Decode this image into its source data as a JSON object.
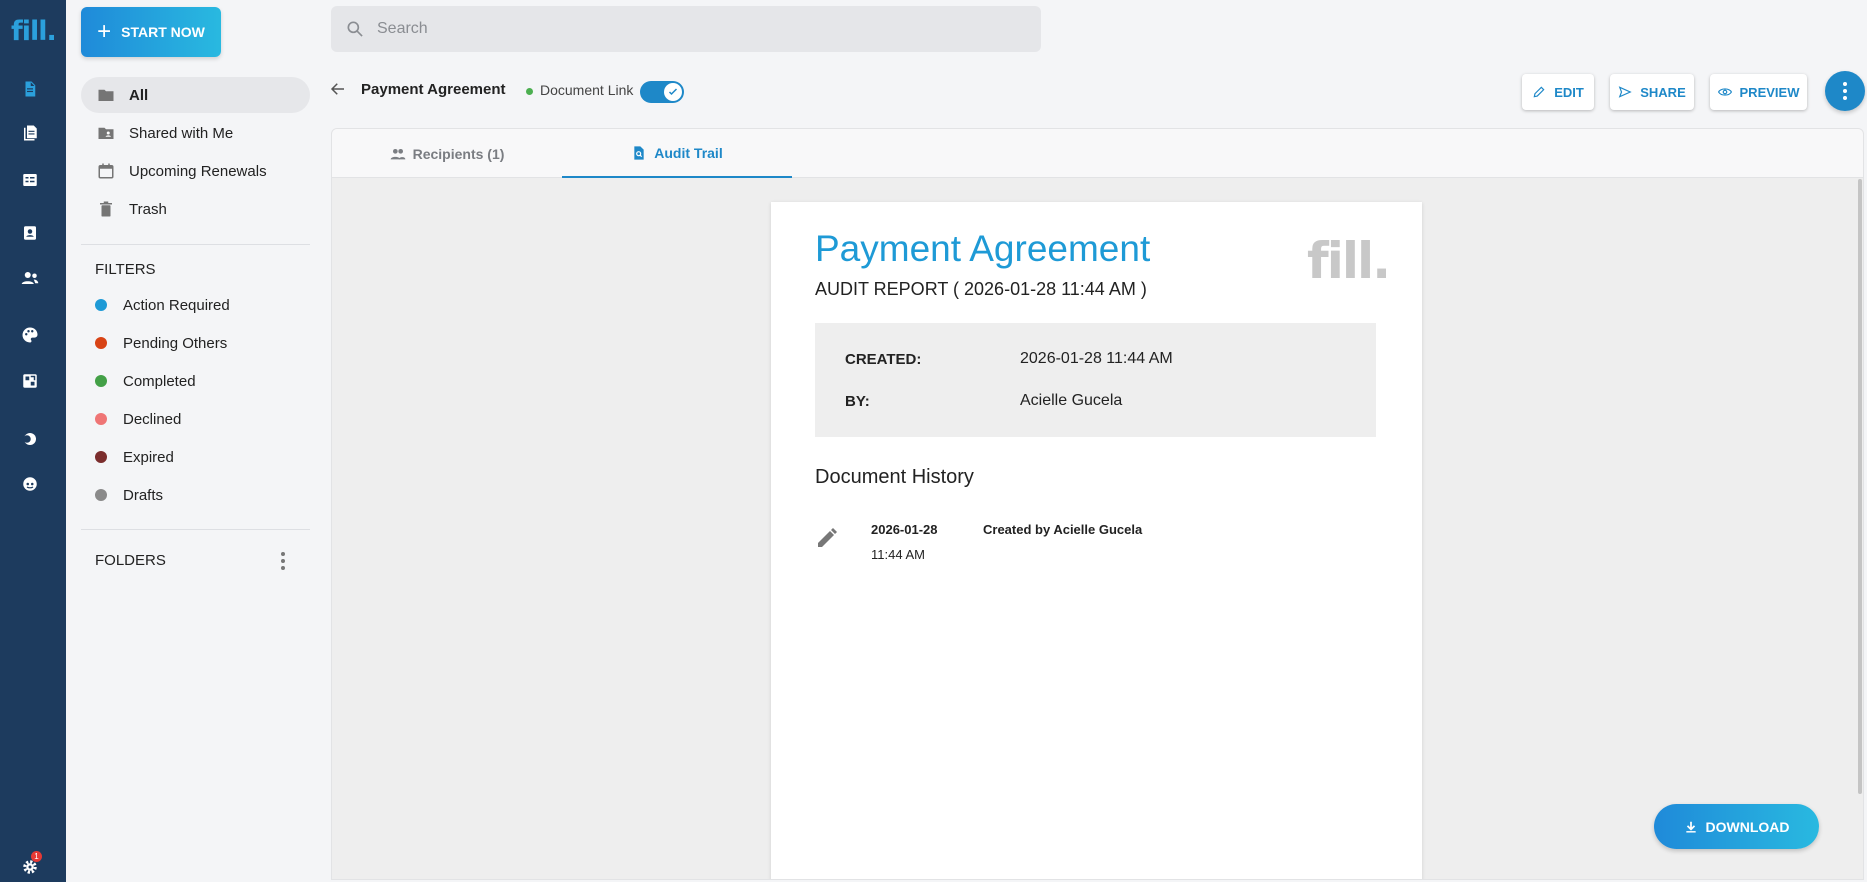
{
  "brand": {
    "logo_text": "fill."
  },
  "start_button": {
    "label": "START NOW"
  },
  "search": {
    "placeholder": "Search"
  },
  "nav": {
    "items": [
      {
        "label": "All",
        "icon": "folder-icon",
        "active": true
      },
      {
        "label": "Shared with Me",
        "icon": "shared-folder-icon"
      },
      {
        "label": "Upcoming Renewals",
        "icon": "calendar-icon"
      },
      {
        "label": "Trash",
        "icon": "trash-icon"
      }
    ]
  },
  "filters": {
    "heading": "FILTERS",
    "items": [
      {
        "label": "Action Required",
        "color": "#1e9ad6"
      },
      {
        "label": "Pending Others",
        "color": "#d84315"
      },
      {
        "label": "Completed",
        "color": "#43a047"
      },
      {
        "label": "Declined",
        "color": "#ef7575"
      },
      {
        "label": "Expired",
        "color": "#7b2d2d"
      },
      {
        "label": "Drafts",
        "color": "#8a8a8a"
      }
    ]
  },
  "folders": {
    "heading": "FOLDERS"
  },
  "document": {
    "title": "Payment Agreement",
    "link_label": "Document Link",
    "link_enabled": true
  },
  "actions": {
    "edit": "EDIT",
    "share": "SHARE",
    "preview": "PREVIEW"
  },
  "tabs": [
    {
      "label": "Recipients (1)",
      "icon": "people-icon"
    },
    {
      "label": "Audit Trail",
      "icon": "audit-doc-icon",
      "active": true
    }
  ],
  "report": {
    "title": "Payment Agreement",
    "subtitle": "AUDIT REPORT ( 2026-01-28 11:44 AM )",
    "logo": "fill.",
    "created_key": "CREATED:",
    "created_val": "2026-01-28 11:44 AM",
    "by_key": "BY:",
    "by_val": "Acielle Gucela",
    "history_title": "Document History",
    "history": [
      {
        "date": "2026-01-28",
        "time": "11:44 AM",
        "description": "Created by Acielle Gucela",
        "icon": "pencil-icon"
      }
    ]
  },
  "download": {
    "label": "DOWNLOAD"
  },
  "notifications": {
    "count": "1"
  },
  "colors": {
    "accent": "#1e88c8",
    "rail": "#1d3b5e",
    "title_blue": "#1e9ad6"
  }
}
